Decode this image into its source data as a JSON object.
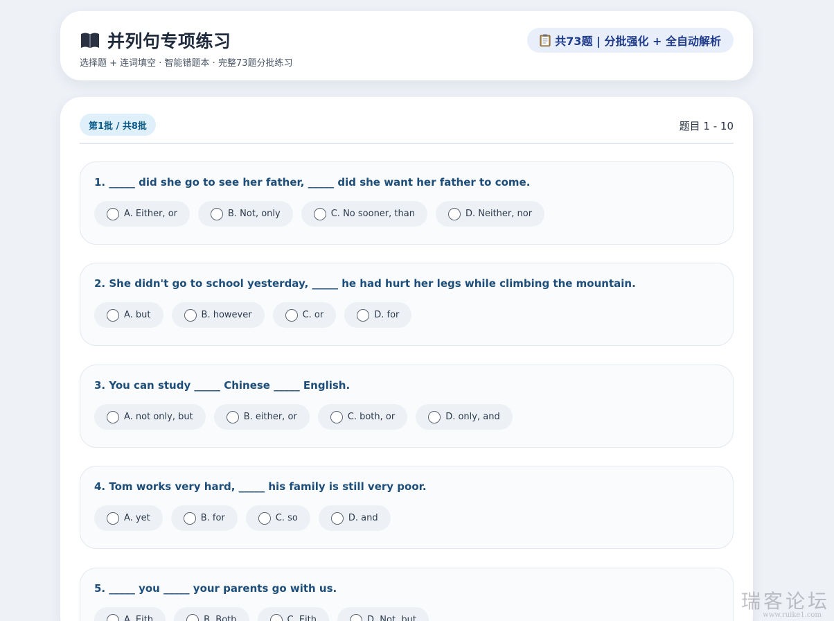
{
  "header": {
    "title": "并列句专项练习",
    "subtitle": "选择题 + 连词填空 · 智能错题本 · 完整73题分批练习",
    "summary": "共73题 | 分批强化 + 全自动解析",
    "title_icon": "book-icon",
    "summary_icon": "clipboard-icon"
  },
  "batch": {
    "badge": "第1批 / 共8批",
    "range": "题目 1 - 10"
  },
  "questions": [
    {
      "text": "1. _____ did she go to see her father, _____ did she want her father to come.",
      "options": [
        "A. Either, or",
        "B. Not, only",
        "C. No sooner, than",
        "D. Neither, nor"
      ]
    },
    {
      "text": "2. She didn't go to school yesterday, _____ he had hurt her legs while climbing the mountain.",
      "options": [
        "A. but",
        "B. however",
        "C. or",
        "D. for"
      ]
    },
    {
      "text": "3. You can study _____ Chinese _____ English.",
      "options": [
        "A. not only, but",
        "B. either, or",
        "C. both, or",
        "D. only, and"
      ]
    },
    {
      "text": "4. Tom works very hard, _____ his family is still very poor.",
      "options": [
        "A. yet",
        "B. for",
        "C. so",
        "D. and"
      ]
    },
    {
      "text": "5. _____ you _____ your parents go with us.",
      "options": [
        "A. Eith",
        "B. Both",
        "C. Eith",
        "D. Not, but"
      ]
    }
  ],
  "watermark": {
    "text": "瑞客论坛",
    "sub": "www.ruike1.com"
  },
  "colors": {
    "background": "#eef1f6",
    "title": "#1f2a3c",
    "question_text": "#1d4e7a",
    "badge_bg": "#dff0fb",
    "pill_text": "#1e3a8a"
  }
}
